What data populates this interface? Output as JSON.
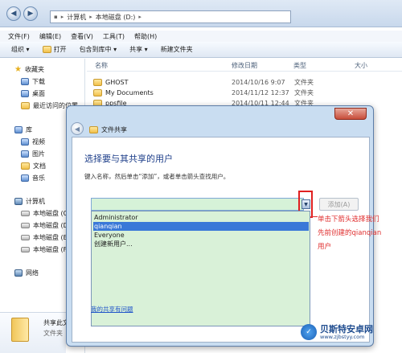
{
  "explorer": {
    "address": [
      "计算机",
      "本地磁盘 (D:)"
    ],
    "menu": [
      "文件(F)",
      "编辑(E)",
      "查看(V)",
      "工具(T)",
      "帮助(H)"
    ],
    "toolbar": [
      "组织 ▾",
      "打开",
      "包含到库中 ▾",
      "共享 ▾",
      "新建文件夹"
    ],
    "columns": {
      "name": "名称",
      "date": "修改日期",
      "type": "类型",
      "size": "大小"
    },
    "files": [
      {
        "name": "GHOST",
        "date": "2014/10/16 9:07",
        "type": "文件夹"
      },
      {
        "name": "My Documents",
        "date": "2014/11/12 12:37",
        "type": "文件夹"
      },
      {
        "name": "ppsfile",
        "date": "2014/10/11 12:44",
        "type": "文件夹"
      }
    ],
    "nav": {
      "favorites": "收藏夹",
      "fav_items": [
        "下载",
        "桌面",
        "最近访问的位置"
      ],
      "libraries": "库",
      "lib_items": [
        "视频",
        "图片",
        "文档",
        "音乐"
      ],
      "computer": "计算机",
      "drives": [
        "本地磁盘 (C:)",
        "本地磁盘 (D:)",
        "本地磁盘 (E:)",
        "本地磁盘 (F:)"
      ],
      "network": "网络"
    },
    "status": {
      "name": "共享此文",
      "type": "文件夹"
    }
  },
  "dialog": {
    "caption": "文件共享",
    "heading": "选择要与其共享的用户",
    "instruction": "键入名称，然后单击“添加”，或者单击箭头查找用户。",
    "input_value": "",
    "add_label": "添加(A)",
    "options": [
      "Administrator",
      "qianqian",
      "Everyone",
      "创建新用户..."
    ],
    "selected_index": 1,
    "help_link": "我的共享有问题"
  },
  "annotation": {
    "lines": [
      "单击下箭头选择我们",
      "先前创建的qianqian",
      "用户"
    ]
  },
  "watermark": {
    "title": "贝斯特安卓网",
    "url": "www.zjbstyy.com"
  }
}
